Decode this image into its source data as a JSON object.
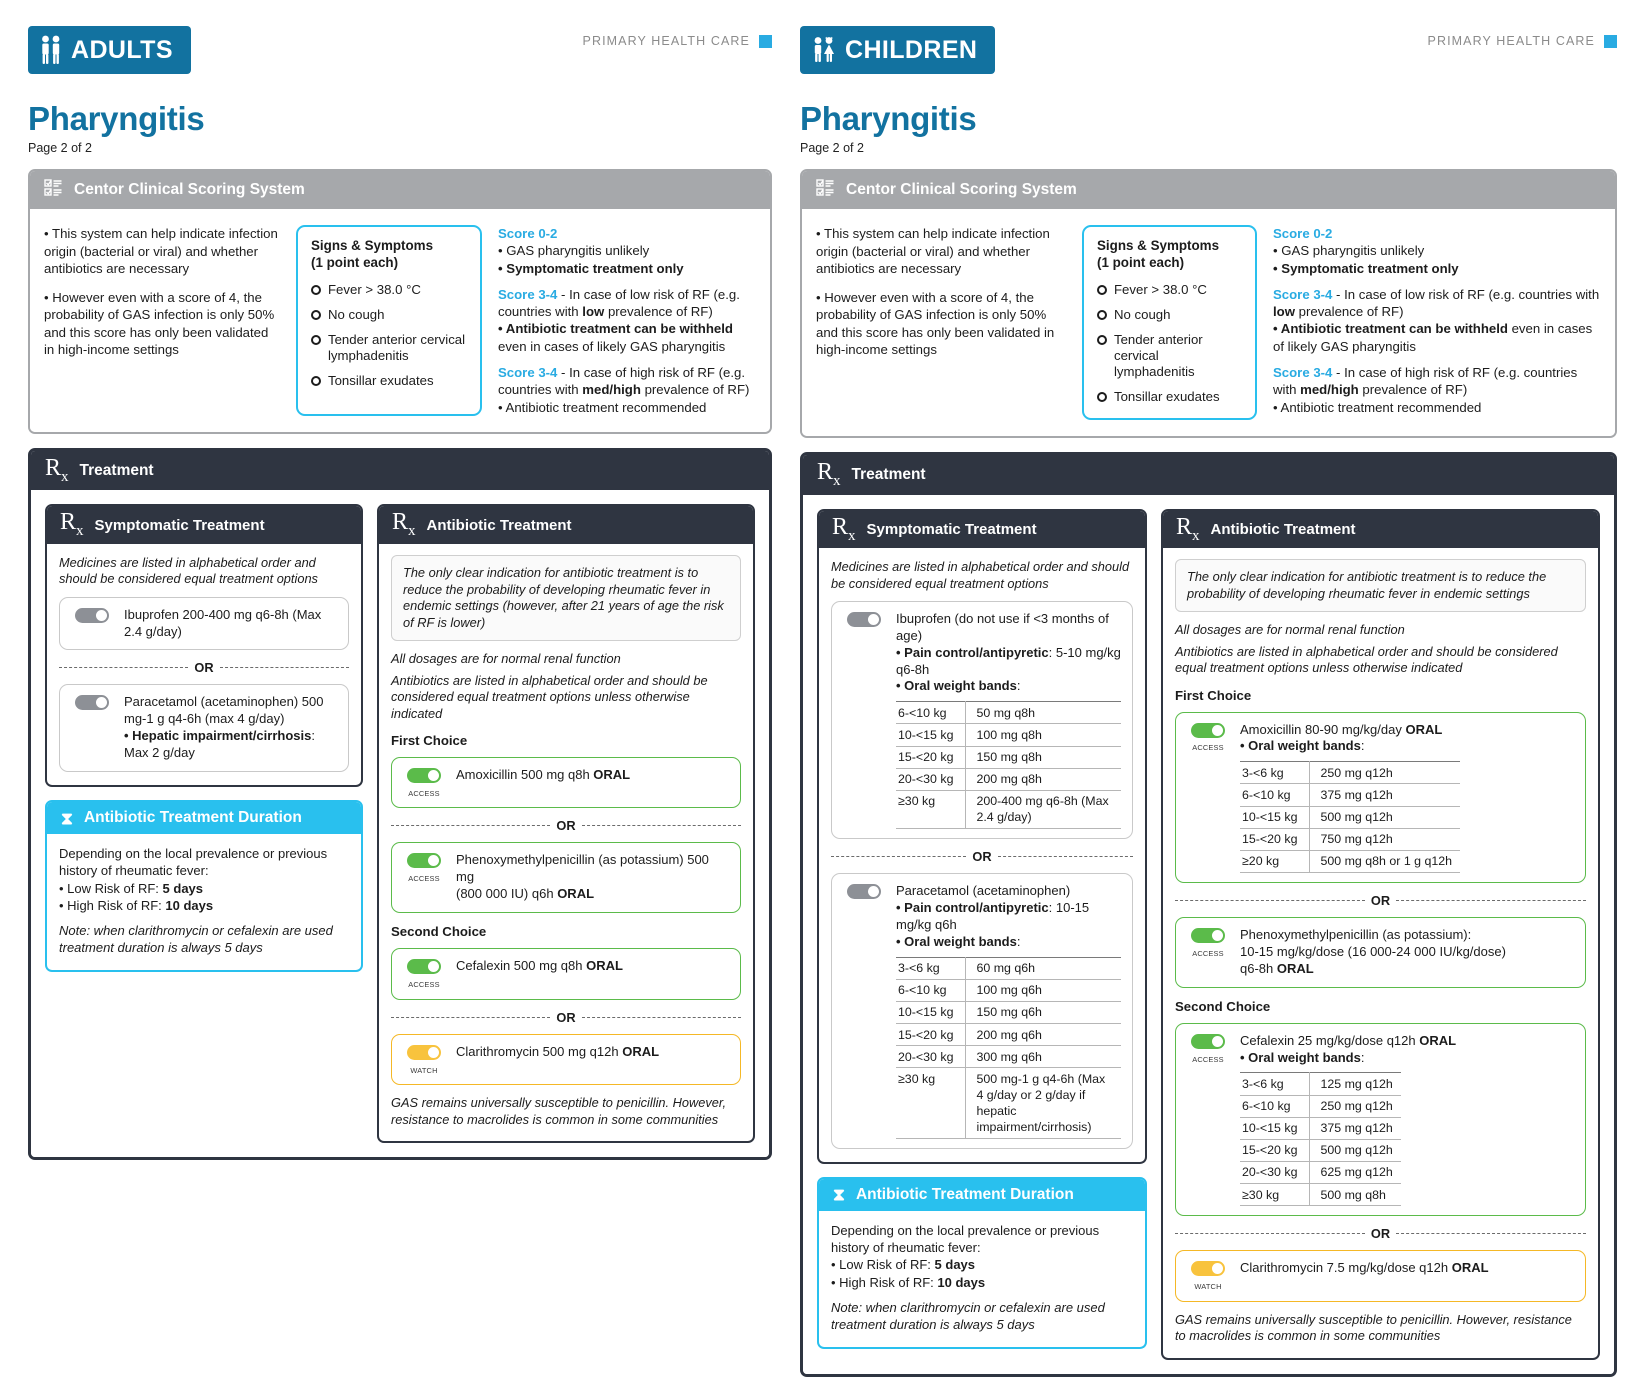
{
  "adults": {
    "badge": "ADULTS",
    "badge_icon": "two-adults-icon",
    "phc": "PRIMARY HEALTH CARE",
    "title": "Pharyngitis",
    "page": "Page 2 of 2",
    "centor": {
      "heading": "Centor Clinical Scoring System",
      "intro1": "• This system can help indicate infection origin (bacterial or viral) and whether antibiotics are necessary",
      "intro2": "• However even with a score of 4, the probability of GAS infection is only 50% and this score has only been validated in high-income settings",
      "signs_title": "Signs & Symptoms",
      "signs_sub": "(1 point each)",
      "signs": [
        "Fever > 38.0 °C",
        "No cough",
        "Tender anterior cervical lymphadenitis",
        "Tonsillar exudates"
      ],
      "score_a_label": "Score 0-2",
      "score_a_line1": "• GAS pharyngitis unlikely",
      "score_a_line2": "• Symptomatic treatment only",
      "score_b_label": "Score 3-4",
      "score_b_line1": " - In case of low risk of RF (e.g. countries with ",
      "score_b_bold": "low",
      "score_b_line2": " prevalence of RF)",
      "score_b_line3": "• Antibiotic treatment can be withheld",
      "score_b_line4": " even in cases of likely GAS pharyngitis",
      "score_c_label": "Score 3-4",
      "score_c_line1": " - In case of high risk of RF (e.g. countries with ",
      "score_c_bold": "med/high",
      "score_c_line2": " prevalence of RF)",
      "score_c_line3": "• Antibiotic treatment recommended"
    },
    "treatment_heading": "Treatment",
    "symptomatic": {
      "heading": "Symptomatic Treatment",
      "note": "Medicines are listed in alphabetical order and should be considered equal treatment options",
      "or": "OR",
      "med1": "Ibuprofen 200-400 mg q6-8h (Max 2.4 g/day)",
      "med2_line1": "Paracetamol (acetaminophen) 500 mg-1 g q4-6h (max 4 g/day)",
      "med2_bullet_bold": "• Hepatic impairment/cirrhosis",
      "med2_bullet_rest": ": Max 2 g/day"
    },
    "duration": {
      "heading": "Antibiotic Treatment Duration",
      "intro": "Depending on the local prevalence or previous history of rheumatic fever:",
      "low_label": "• Low Risk of RF: ",
      "low_value": "5 days",
      "high_label": "• High Risk of RF: ",
      "high_value": "10 days",
      "note": "Note: when clarithromycin or cefalexin are used treatment duration is always 5 days"
    },
    "antibiotic": {
      "heading": "Antibiotic Treatment",
      "notebox": "The only clear indication for antibiotic treatment is to reduce the probability of developing rheumatic fever in endemic settings (however, after 21 years of age the risk of RF is lower)",
      "ital1": "All dosages are for normal renal function",
      "ital2": "Antibiotics are listed in alphabetical order and should be considered equal treatment options unless otherwise indicated",
      "first_choice": "First Choice",
      "second_choice": "Second Choice",
      "or": "OR",
      "amox_name": "Amoxicillin 500 mg q8h ",
      "amox_route": "ORAL",
      "amox_class": "ACCESS",
      "pheno_line1": "Phenoxymethylpenicillin (as potassium) 500 mg",
      "pheno_line2": "(800 000 IU) q6h ",
      "pheno_route": "ORAL",
      "pheno_class": "ACCESS",
      "cefa_name": "Cefalexin 500 mg q8h ",
      "cefa_route": "ORAL",
      "cefa_class": "ACCESS",
      "clari_name": "Clarithromycin 500 mg q12h ",
      "clari_route": "ORAL",
      "clari_class": "WATCH",
      "tail": "GAS remains universally susceptible to penicillin. However, resistance to macrolides is common in some communities"
    }
  },
  "children": {
    "badge": "CHILDREN",
    "badge_icon": "two-children-icon",
    "phc": "PRIMARY HEALTH CARE",
    "title": "Pharyngitis",
    "page": "Page 2 of 2",
    "centor": {
      "heading": "Centor Clinical Scoring System",
      "intro1": "• This system can help indicate infection origin (bacterial or viral) and whether antibiotics are necessary",
      "intro2": "• However even with a score of 4, the probability of GAS infection is only 50% and this score has only been validated in high-income settings",
      "signs_title": "Signs & Symptoms",
      "signs_sub": "(1 point each)",
      "signs": [
        "Fever > 38.0 °C",
        "No cough",
        "Tender anterior cervical lymphadenitis",
        "Tonsillar exudates"
      ],
      "score_a_label": "Score 0-2",
      "score_a_line1": "• GAS pharyngitis unlikely",
      "score_a_line2": "• Symptomatic treatment only",
      "score_b_label": "Score 3-4",
      "score_b_line1": " - In case of low risk of RF (e.g. countries with ",
      "score_b_bold": "low",
      "score_b_line2": " prevalence of RF)",
      "score_b_line3": "• Antibiotic treatment can be withheld",
      "score_b_line4": " even in cases of likely GAS pharyngitis",
      "score_c_label": "Score 3-4",
      "score_c_line1": " - In case of high risk of RF (e.g. countries with ",
      "score_c_bold": "med/high",
      "score_c_line2": " prevalence of RF)",
      "score_c_line3": "• Antibiotic treatment recommended"
    },
    "treatment_heading": "Treatment",
    "symptomatic": {
      "heading": "Symptomatic Treatment",
      "note": "Medicines are listed in alphabetical order and should be considered equal treatment options",
      "or": "OR",
      "ibu_name": "Ibuprofen (do not use if <3 months of age)",
      "ibu_bullet1_bold": "• Pain control/antipyretic",
      "ibu_bullet1_rest": ": 5-10 mg/kg q6-8h",
      "ibu_bullet2_bold": "• Oral weight bands",
      "ibu_bullet2_rest": ":",
      "ibu_bands": [
        [
          "6-<10 kg",
          "50 mg q8h"
        ],
        [
          "10-<15 kg",
          "100 mg q8h"
        ],
        [
          "15-<20 kg",
          "150 mg q8h"
        ],
        [
          "20-<30 kg",
          "200 mg q8h"
        ],
        [
          "≥30 kg",
          "200-400 mg q6-8h (Max 2.4 g/day)"
        ]
      ],
      "para_name": "Paracetamol (acetaminophen)",
      "para_bullet1_bold": "• Pain control/antipyretic",
      "para_bullet1_rest": ": 10-15 mg/kg q6h",
      "para_bullet2_bold": "• Oral weight bands",
      "para_bullet2_rest": ":",
      "para_bands": [
        [
          "3-<6 kg",
          "60 mg q6h"
        ],
        [
          "6-<10 kg",
          "100 mg q6h"
        ],
        [
          "10-<15 kg",
          "150 mg q6h"
        ],
        [
          "15-<20 kg",
          "200 mg q6h"
        ],
        [
          "20-<30 kg",
          "300 mg q6h"
        ],
        [
          "≥30 kg",
          "500 mg-1 g q4-6h (Max 4 g/day or 2 g/day if hepatic impairment/cirrhosis)"
        ]
      ]
    },
    "duration": {
      "heading": "Antibiotic Treatment Duration",
      "intro": "Depending on the local prevalence or previous history of rheumatic fever:",
      "low_label": "• Low Risk of RF: ",
      "low_value": "5 days",
      "high_label": "• High Risk of RF: ",
      "high_value": "10 days",
      "note": "Note: when clarithromycin or cefalexin are used treatment duration is always 5 days"
    },
    "antibiotic": {
      "heading": "Antibiotic Treatment",
      "notebox": "The only clear indication for antibiotic treatment is to reduce the probability of developing rheumatic fever in endemic settings",
      "ital1": "All dosages are for normal renal function",
      "ital2": "Antibiotics are listed in alphabetical order and should be considered equal treatment options unless otherwise indicated",
      "first_choice": "First Choice",
      "second_choice": "Second Choice",
      "or": "OR",
      "amox_name": "Amoxicillin 80-90 mg/kg/day ",
      "amox_route": "ORAL",
      "amox_class": "ACCESS",
      "amox_bullet_bold": "• Oral weight bands",
      "amox_bullet_rest": ":",
      "amox_bands": [
        [
          "3-<6 kg",
          "250 mg q12h"
        ],
        [
          "6-<10 kg",
          "375 mg q12h"
        ],
        [
          "10-<15 kg",
          "500 mg q12h"
        ],
        [
          "15-<20 kg",
          "750 mg q12h"
        ],
        [
          "≥20 kg",
          "500 mg q8h or 1 g q12h"
        ]
      ],
      "pheno_line1": "Phenoxymethylpenicillin (as potassium):",
      "pheno_line2": "10-15 mg/kg/dose (16 000-24 000 IU/kg/dose)",
      "pheno_line3": "q6-8h ",
      "pheno_route": "ORAL",
      "pheno_class": "ACCESS",
      "cefa_name": "Cefalexin 25 mg/kg/dose q12h ",
      "cefa_route": "ORAL",
      "cefa_class": "ACCESS",
      "cefa_bullet_bold": "• Oral weight bands",
      "cefa_bullet_rest": ":",
      "cefa_bands": [
        [
          "3-<6 kg",
          "125 mg q12h"
        ],
        [
          "6-<10 kg",
          "250 mg q12h"
        ],
        [
          "10-<15 kg",
          "375 mg q12h"
        ],
        [
          "15-<20 kg",
          "500 mg q12h"
        ],
        [
          "20-<30 kg",
          "625 mg q12h"
        ],
        [
          "≥30 kg",
          "500 mg q8h"
        ]
      ],
      "clari_name": "Clarithromycin 7.5 mg/kg/dose q12h ",
      "clari_route": "ORAL",
      "clari_class": "WATCH",
      "tail": "GAS remains universally susceptible to penicillin. However, resistance to macrolides is common in some communities"
    }
  },
  "colors": {
    "brand_blue": "#1272a0",
    "cyan": "#29c0ee",
    "dark": "#2f3541",
    "grey": "#a6a8ab",
    "access_green": "#5bbb4a",
    "watch_yellow": "#f5b826"
  }
}
